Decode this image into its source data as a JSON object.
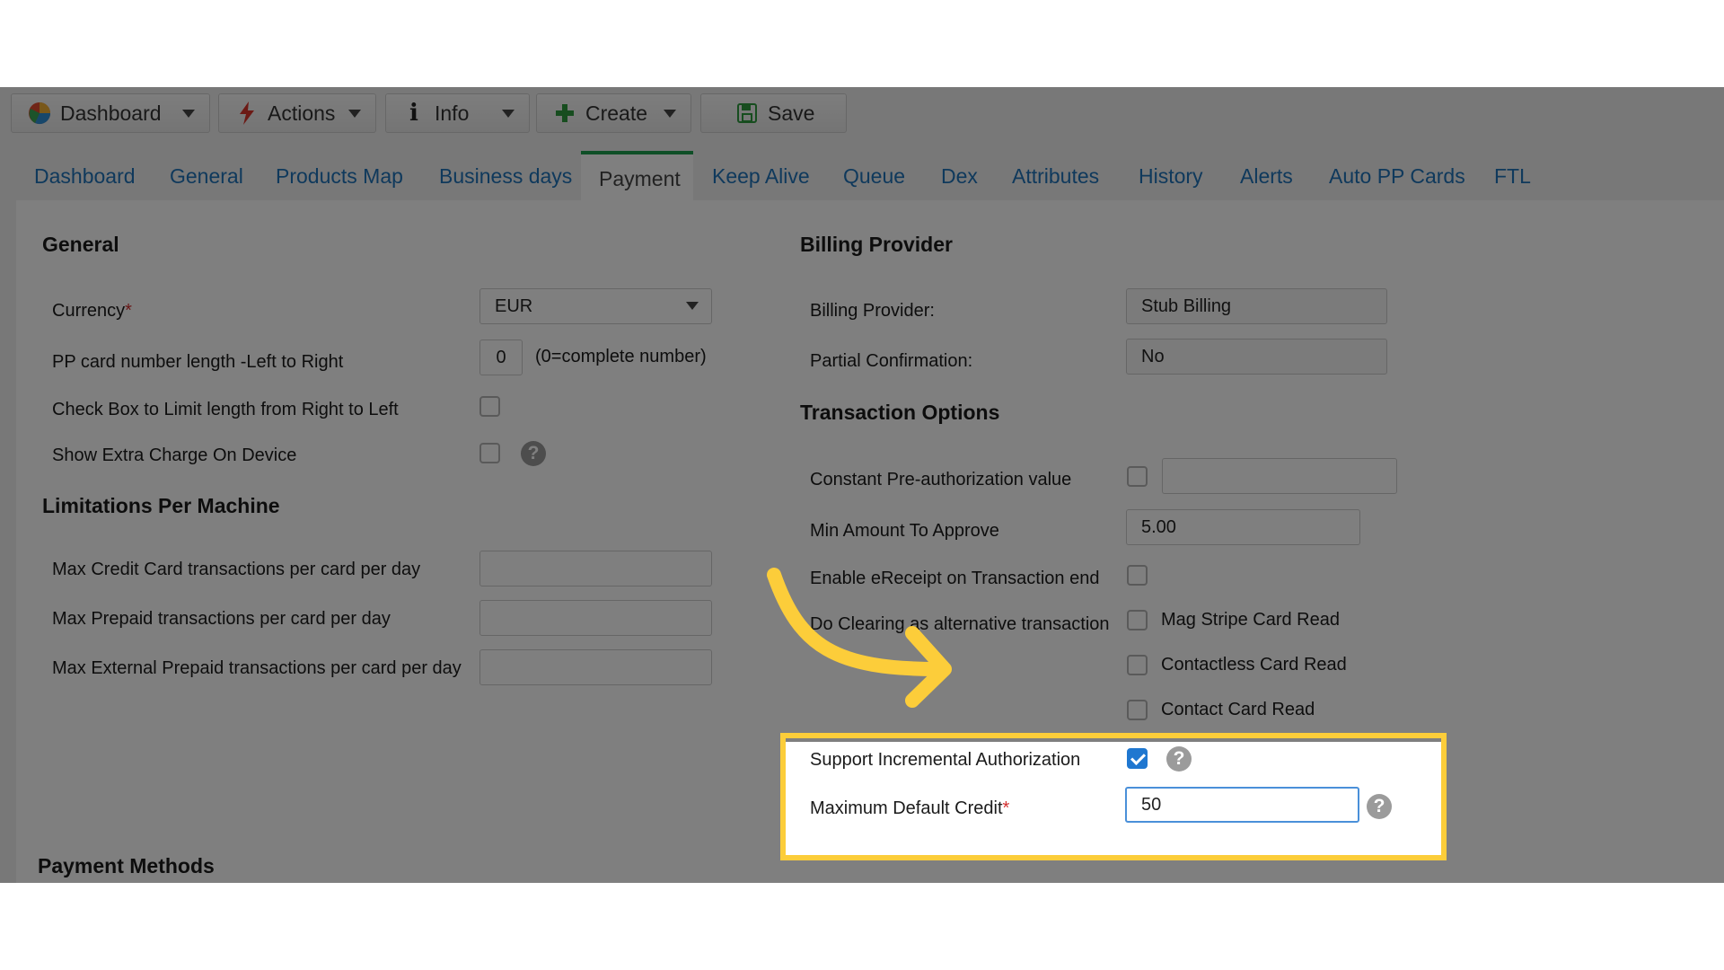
{
  "toolbar": {
    "dashboard": "Dashboard",
    "actions": "Actions",
    "info": "Info",
    "create": "Create",
    "save": "Save"
  },
  "tabs": [
    "Dashboard",
    "General",
    "Products Map",
    "Business days",
    "Payment",
    "Keep Alive",
    "Queue",
    "Dex",
    "Attributes",
    "History",
    "Alerts",
    "Auto PP Cards",
    "FTL"
  ],
  "general": {
    "heading": "General",
    "currency_label": "Currency",
    "required_mark": "*",
    "currency_value": "EUR",
    "pp_length_label": "PP card number length -Left to Right",
    "pp_length_value": "0",
    "pp_length_hint": "(0=complete number)",
    "limit_rtl_label": "Check Box to Limit length from Right to Left",
    "extra_charge_label": "Show Extra Charge On Device"
  },
  "limitations": {
    "heading": "Limitations Per Machine",
    "max_credit_label": "Max Credit Card transactions per card per day",
    "max_prepaid_label": "Max Prepaid transactions per card per day",
    "max_ext_prepaid_label": "Max External Prepaid transactions per card per day"
  },
  "billing": {
    "heading": "Billing Provider",
    "provider_label": "Billing Provider:",
    "provider_value": "Stub Billing",
    "partial_label": "Partial Confirmation:",
    "partial_value": "No"
  },
  "transaction": {
    "heading": "Transaction Options",
    "const_preauth_label": "Constant Pre-authorization value",
    "min_amount_label": "Min Amount To Approve",
    "min_amount_value": "5.00",
    "ereceipt_label": "Enable eReceipt on Transaction end",
    "clearing_label": "Do Clearing as alternative transaction",
    "mag_stripe": "Mag Stripe Card Read",
    "contactless": "Contactless Card Read",
    "contact": "Contact Card Read",
    "incremental_label": "Support Incremental Authorization",
    "incremental_checked": true,
    "max_credit_label": "Maximum Default Credit",
    "max_credit_value": "50"
  },
  "payment_methods": {
    "heading": "Payment Methods"
  },
  "colors": {
    "accent": "#1f72b8",
    "active_tab": "#1e9e4e",
    "highlight": "#fccd3a",
    "checkbox": "#1f77d0"
  }
}
